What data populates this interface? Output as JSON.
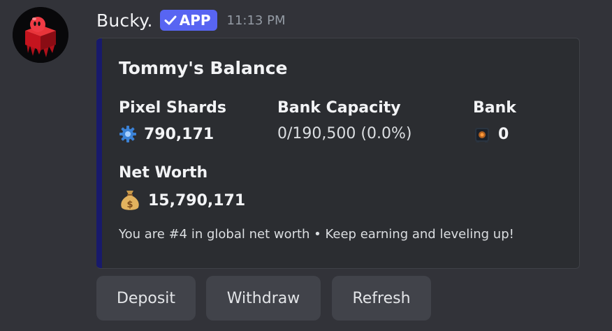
{
  "message": {
    "author": "Bucky.",
    "badge": "APP",
    "timestamp": "11:13 PM",
    "avatar_icon": "red-cube-character-icon"
  },
  "embed": {
    "accent_color": "#181a6b",
    "title": "Tommy's Balance",
    "fields": {
      "pixel_shards": {
        "name": "Pixel Shards",
        "value": "790,171",
        "icon": "blue-gear-shard-icon"
      },
      "bank_capacity": {
        "name": "Bank Capacity",
        "value": "0/190,500 (0.0%)"
      },
      "bank": {
        "name": "Bank",
        "value": "0",
        "icon": "bank-vault-icon"
      },
      "net_worth": {
        "name": "Net Worth",
        "value": "15,790,171",
        "icon": "money-bag-icon"
      }
    },
    "footer": "You are #4 in global net worth • Keep earning and leveling up!"
  },
  "buttons": {
    "deposit": "Deposit",
    "withdraw": "Withdraw",
    "refresh": "Refresh"
  },
  "colors": {
    "background": "#323339",
    "embed_background": "#2b2d31",
    "badge": "#5865f2",
    "button": "#41434a"
  }
}
